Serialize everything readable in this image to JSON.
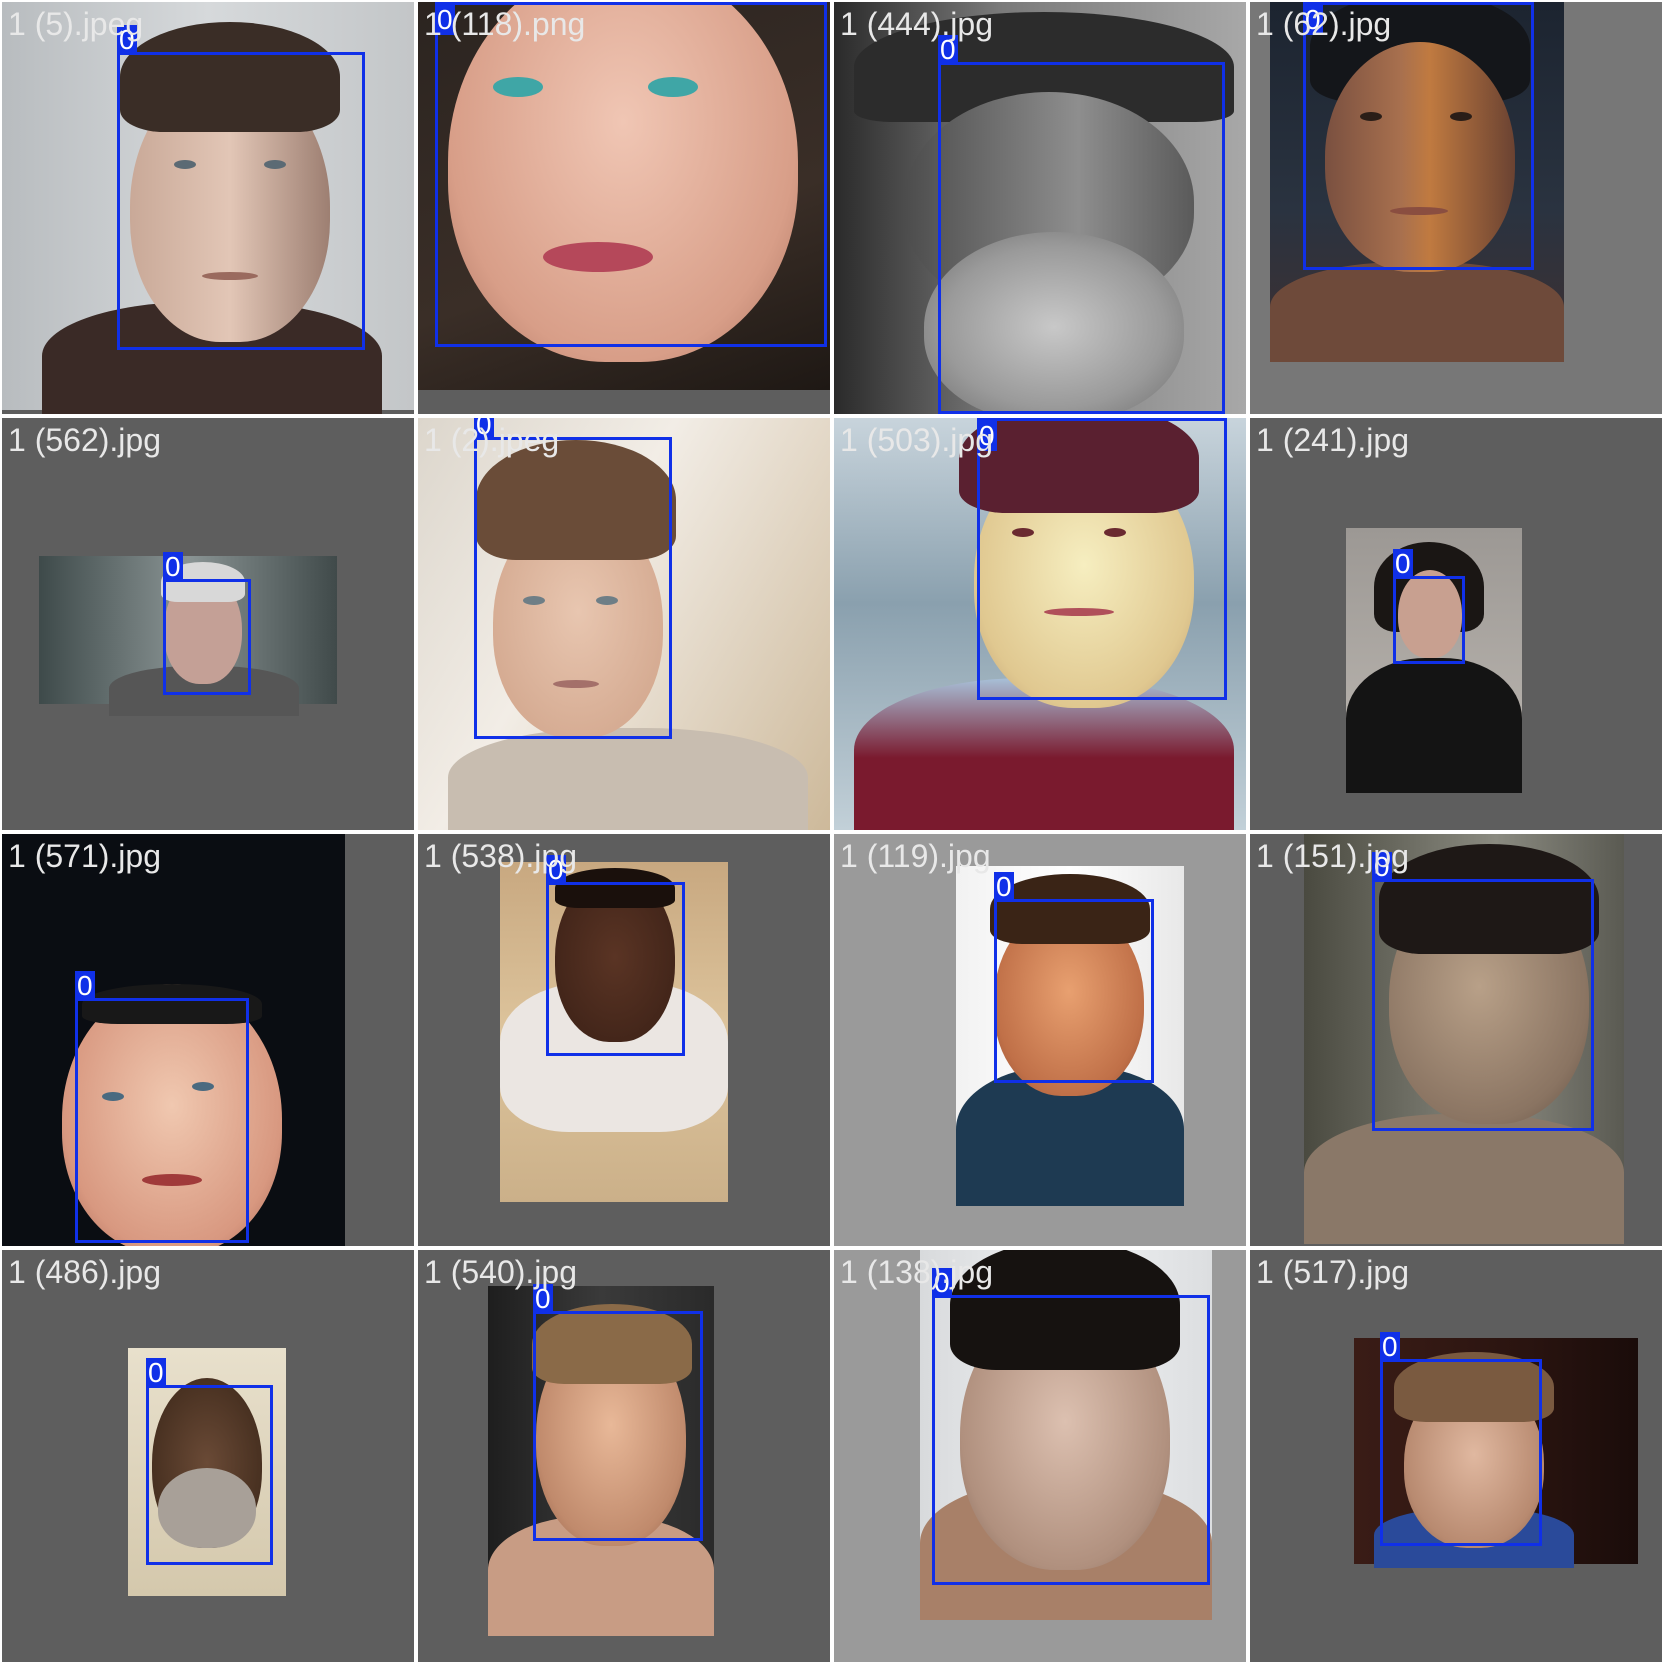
{
  "colors": {
    "box": "#1030e8",
    "tile_gray": "#5e5e5e",
    "tile_light_gray": "#9a9a9a",
    "label_text": "#e8e8e8"
  },
  "class_label": "0",
  "tiles": [
    {
      "name": "1 (5).jpeg"
    },
    {
      "name": "1 (118).png"
    },
    {
      "name": "1 (444).jpg"
    },
    {
      "name": "1 (62).jpg"
    },
    {
      "name": "1 (562).jpg"
    },
    {
      "name": "1 (2).jpeg"
    },
    {
      "name": "1 (503).jpg"
    },
    {
      "name": "1 (241).jpg"
    },
    {
      "name": "1 (571).jpg"
    },
    {
      "name": "1 (538).jpg"
    },
    {
      "name": "1 (119).jpg"
    },
    {
      "name": "1 (151).jpg"
    },
    {
      "name": "1 (486).jpg"
    },
    {
      "name": "1 (540).jpg"
    },
    {
      "name": "1 (138).jpg"
    },
    {
      "name": "1 (517).jpg"
    }
  ]
}
